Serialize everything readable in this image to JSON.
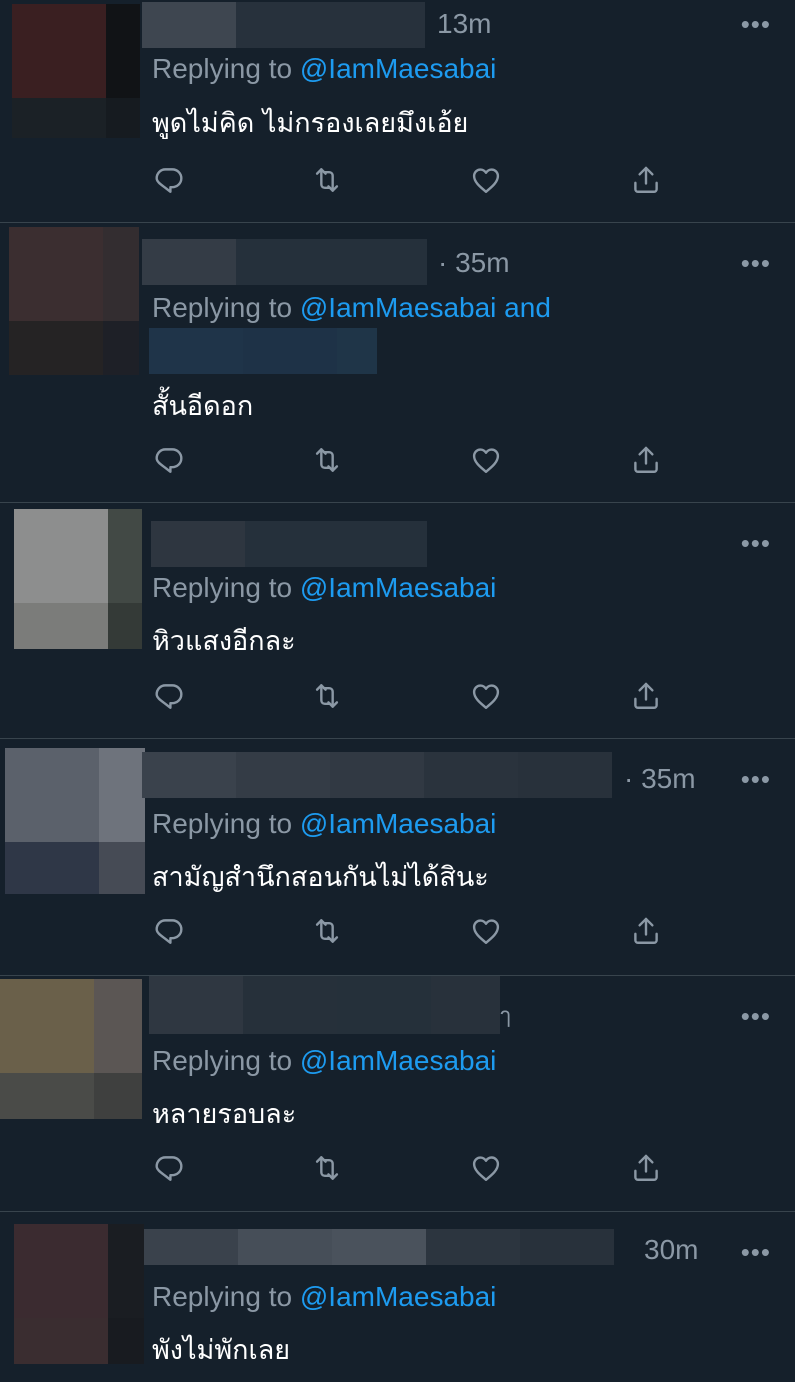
{
  "colors": {
    "background": "#15202b",
    "divider": "#38444d",
    "secondary_text": "#8b98a5",
    "mention": "#1d9bf0",
    "primary_text": "#ffffff"
  },
  "icons": {
    "reply": "reply-icon",
    "retweet": "retweet-icon",
    "like": "heart-icon",
    "share": "share-icon",
    "more": "more-icon"
  },
  "tweets": [
    {
      "time": "13m",
      "reply_prefix": "Replying to",
      "mention": "@IamMaesabai",
      "mention_extra": "",
      "text": "พูดไม่คิด ไม่กรองเลยมึงเอ้ย",
      "more": "•••"
    },
    {
      "time": "· 35m",
      "reply_prefix": "Replying to",
      "mention": "@IamMaesabai",
      "mention_extra": "and",
      "text": "สั้นอีดอก",
      "more": "•••"
    },
    {
      "time": "",
      "reply_prefix": "Replying to",
      "mention": "@IamMaesabai",
      "mention_extra": "",
      "text": "หิวแสงอีกละ",
      "more": "•••"
    },
    {
      "time": "· 35m",
      "reply_prefix": "Replying to",
      "mention": "@IamMaesabai",
      "mention_extra": "",
      "text": "สามัญสำนึกสอนกันไม่ได้สินะ",
      "more": "•••"
    },
    {
      "time": "ๅ",
      "reply_prefix": "Replying to",
      "mention": "@IamMaesabai",
      "mention_extra": "",
      "text": "หลายรอบละ",
      "more": "•••"
    },
    {
      "time": "30m",
      "reply_prefix": "Replying to",
      "mention": "@IamMaesabai",
      "mention_extra": "",
      "text": "พังไม่พักเลย",
      "more": "•••"
    }
  ]
}
